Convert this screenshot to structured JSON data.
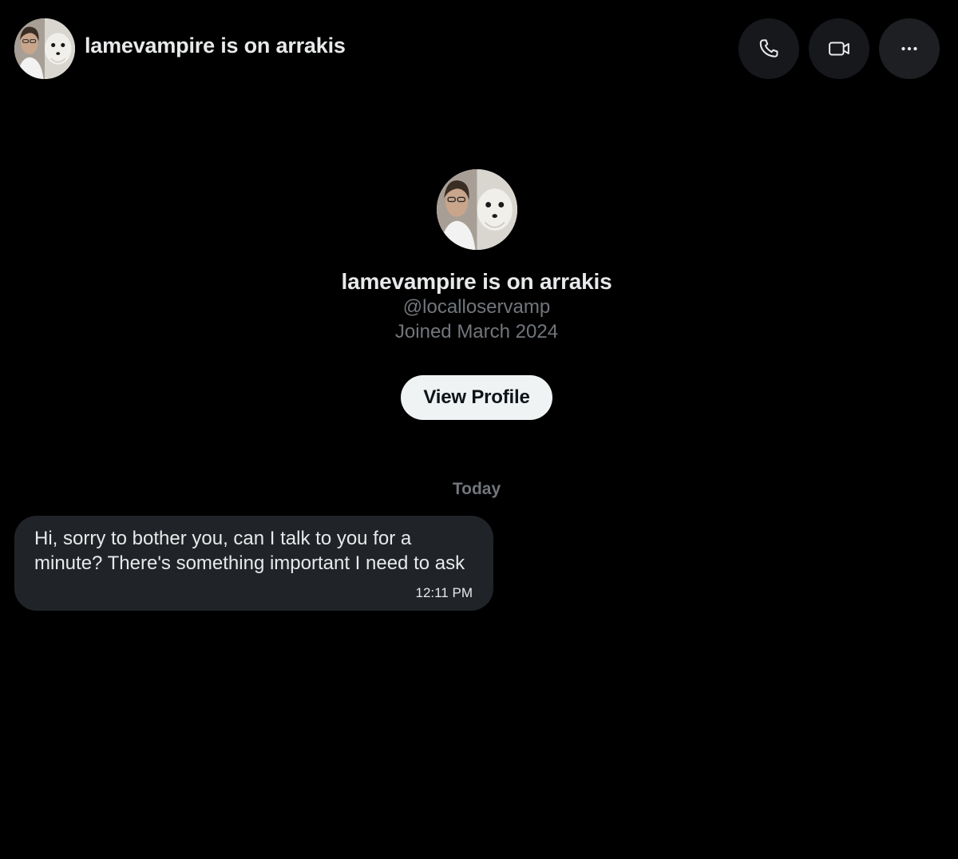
{
  "header": {
    "title": "lamevampire is on arrakis",
    "avatar_icon": "avatar-image",
    "actions": [
      {
        "icon": "phone-icon"
      },
      {
        "icon": "video-camera-icon"
      },
      {
        "icon": "more-horizontal-icon"
      }
    ]
  },
  "profile": {
    "name": "lamevampire is on arrakis",
    "handle": "@localloservamp",
    "joined": "Joined March 2024",
    "view_profile_label": "View Profile"
  },
  "conversation": {
    "day_label": "Today",
    "messages": [
      {
        "text": "Hi, sorry to bother you, can I talk to you for a minute? There's something important I need to ask",
        "time": "12:11 PM"
      }
    ]
  },
  "colors": {
    "background": "#000000",
    "bubble": "#202327",
    "muted_text": "#71767b",
    "primary_text": "#e7e9ea",
    "button_bg": "#eff3f4"
  }
}
